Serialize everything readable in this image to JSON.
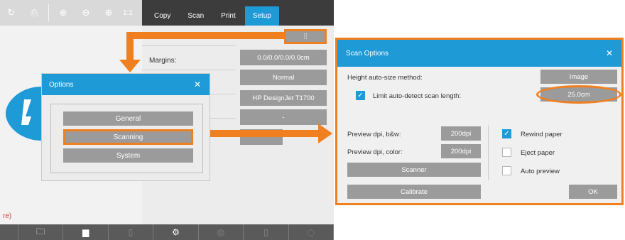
{
  "toolbar": {
    "icons": [
      "rotate-icon",
      "printer-icon",
      "zoom-in-icon",
      "zoom-out-icon",
      "zoom-fit-icon"
    ],
    "zoom_label": "1:1"
  },
  "tabs": [
    {
      "label": "Copy"
    },
    {
      "label": "Scan"
    },
    {
      "label": "Print"
    },
    {
      "label": "Setup",
      "active": true
    }
  ],
  "settings": {
    "margins_label": "Margins:",
    "margins_value": "0.0/0.0/0.0/0.0cm",
    "quality_value": "Normal",
    "printer_value": "HP DesignJet T1700",
    "fourth_value": "-"
  },
  "truncated_text": "re)",
  "bottom_bar": [
    "folder-icon",
    "printer-queue-icon",
    "document-icon",
    "gear-icon",
    "disabled-icon",
    "disabled-icon",
    "disabled-icon"
  ],
  "options_dialog": {
    "title": "Options",
    "close": "✕",
    "buttons": [
      "General",
      "Scanning",
      "System"
    ]
  },
  "scan_options": {
    "title": "Scan Options",
    "close": "✕",
    "height_method_label": "Height auto-size method:",
    "height_method_value": "Image",
    "limit_label": "Limit auto-detect scan length:",
    "limit_checked": true,
    "limit_value": "25.0cm",
    "preview_bw_label": "Preview dpi, b&w:",
    "preview_bw_value": "200dpi",
    "preview_color_label": "Preview dpi, color:",
    "preview_color_value": "200dpi",
    "scanner_button": "Scanner",
    "calibrate_button": "Calibrate",
    "ok_button": "OK",
    "rewind_label": "Rewind paper",
    "rewind_checked": true,
    "eject_label": "Eject paper",
    "eject_checked": false,
    "autopreview_label": "Auto preview",
    "autopreview_checked": false
  },
  "colors": {
    "accent_blue": "#1e9ad6",
    "highlight_orange": "#f07f1f",
    "button_gray": "#9b9b9b"
  }
}
